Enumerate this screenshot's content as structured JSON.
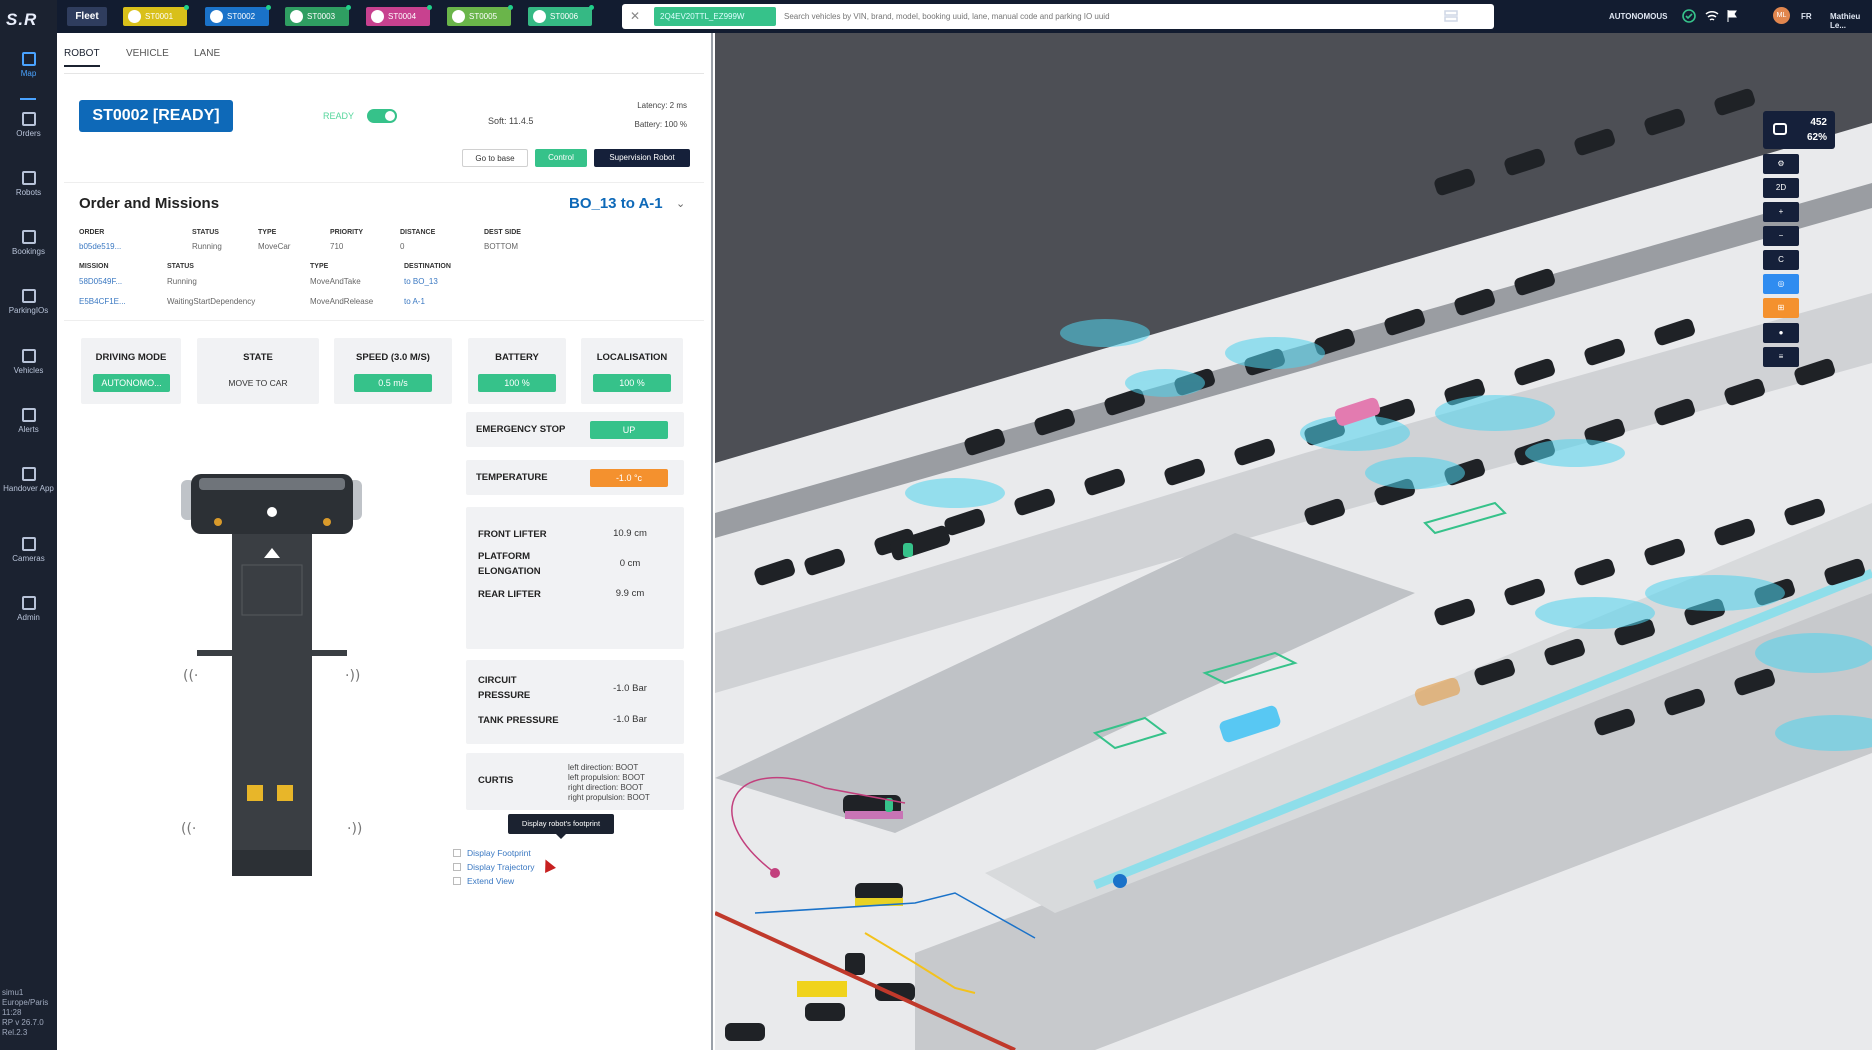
{
  "app": {
    "logo": "S.R",
    "fleet_label": "Fleet"
  },
  "sidebar": {
    "items": [
      {
        "label": "Map",
        "icon": "map-icon",
        "active": true
      },
      {
        "label": "Orders",
        "icon": "orders-icon"
      },
      {
        "label": "Robots",
        "icon": "robot-icon"
      },
      {
        "label": "Bookings",
        "icon": "bookings-icon"
      },
      {
        "label": "ParkingIOs",
        "icon": "parking-io-icon"
      },
      {
        "label": "Vehicles",
        "icon": "vehicle-icon"
      },
      {
        "label": "Alerts",
        "icon": "bell-icon"
      },
      {
        "label": "Handover App",
        "icon": "handover-icon"
      },
      {
        "label": "Cameras",
        "icon": "camera-icon"
      },
      {
        "label": "Admin",
        "icon": "admin-icon"
      }
    ],
    "system": {
      "user": "simu1",
      "timezone": "Europe/Paris",
      "time": "11:28",
      "version": "RP v 26.7.0",
      "build": "Rel.2.3"
    }
  },
  "topbar": {
    "robots": [
      {
        "label": "ST0001",
        "color": "#d9c01a"
      },
      {
        "label": "ST0002",
        "color": "#1a72c9"
      },
      {
        "label": "ST0003",
        "color": "#2f9e62"
      },
      {
        "label": "ST0004",
        "color": "#c8418f"
      },
      {
        "label": "ST0005",
        "color": "#6ab54a"
      },
      {
        "label": "ST0006",
        "color": "#35b984"
      }
    ],
    "search": {
      "tag": "2Q4EV20TTL_EZ999W",
      "placeholder": "Search vehicles by VIN, brand, model, booking uuid, lane, manual code and parking IO uuid"
    },
    "mode": "AUTONOMOUS",
    "lang": "FR",
    "user": "Mathieu Le...",
    "avatar": "ML"
  },
  "tabs": [
    "ROBOT",
    "VEHICLE",
    "LANE"
  ],
  "robot": {
    "title": "ST0002 [READY]",
    "ready_label": "READY",
    "soft": "Soft: 11.4.5",
    "latency": "Latency: 2 ms",
    "battery": "Battery: 100 %"
  },
  "actions": {
    "go_to_base": "Go to base",
    "control": "Control",
    "supervision": "Supervision Robot"
  },
  "orders": {
    "heading": "Order and Missions",
    "route": "BO_13 to A-1",
    "order_headers": [
      "ORDER",
      "STATUS",
      "TYPE",
      "PRIORITY",
      "DISTANCE",
      "DEST SIDE"
    ],
    "order_row": [
      "b05de519...",
      "Running",
      "MoveCar",
      "710",
      "0",
      "BOTTOM"
    ],
    "mission_headers": [
      "MISSION",
      "STATUS",
      "TYPE",
      "DESTINATION"
    ],
    "missions": [
      [
        "58D0549F...",
        "Running",
        "MoveAndTake",
        "to BO_13"
      ],
      [
        "E5B4CF1E...",
        "WaitingStartDependency",
        "MoveAndRelease",
        "to A-1"
      ]
    ]
  },
  "status_cards": [
    {
      "title": "DRIVING MODE",
      "value": "AUTONOMO...",
      "kind": "green"
    },
    {
      "title": "STATE",
      "value": "MOVE TO CAR",
      "kind": "plain"
    },
    {
      "title": "SPEED (3.0 M/S)",
      "value": "0.5 m/s",
      "kind": "green"
    },
    {
      "title": "BATTERY",
      "value": "100 %",
      "kind": "green"
    },
    {
      "title": "LOCALISATION",
      "value": "100 %",
      "kind": "green"
    }
  ],
  "emergency": {
    "label": "EMERGENCY STOP",
    "value": "UP"
  },
  "temperature": {
    "label": "TEMPERATURE",
    "value": "-1.0 °c"
  },
  "lifters": {
    "front_label": "FRONT LIFTER",
    "front_value": "10.9 cm",
    "platform_label": "PLATFORM ELONGATION",
    "platform_value": "0 cm",
    "rear_label": "REAR LIFTER",
    "rear_value": "9.9 cm"
  },
  "pressure": {
    "circuit_label": "CIRCUIT PRESSURE",
    "circuit_value": "-1.0 Bar",
    "tank_label": "TANK PRESSURE",
    "tank_value": "-1.0 Bar"
  },
  "curtis": {
    "label": "CURTIS",
    "lines": [
      "left direction: BOOT",
      "left propulsion: BOOT",
      "right direction: BOOT",
      "right propulsion: BOOT"
    ]
  },
  "tooltip": "Display robot's footprint",
  "display": {
    "footprint": "Display Footprint",
    "trajectory": "Display Trajectory",
    "extend": "Extend View"
  },
  "map": {
    "count": "452",
    "occupancy": "62%",
    "controls": [
      "⚙",
      "2D",
      "+",
      "−",
      "C",
      "◎",
      "⊞",
      "●",
      "≡"
    ]
  }
}
